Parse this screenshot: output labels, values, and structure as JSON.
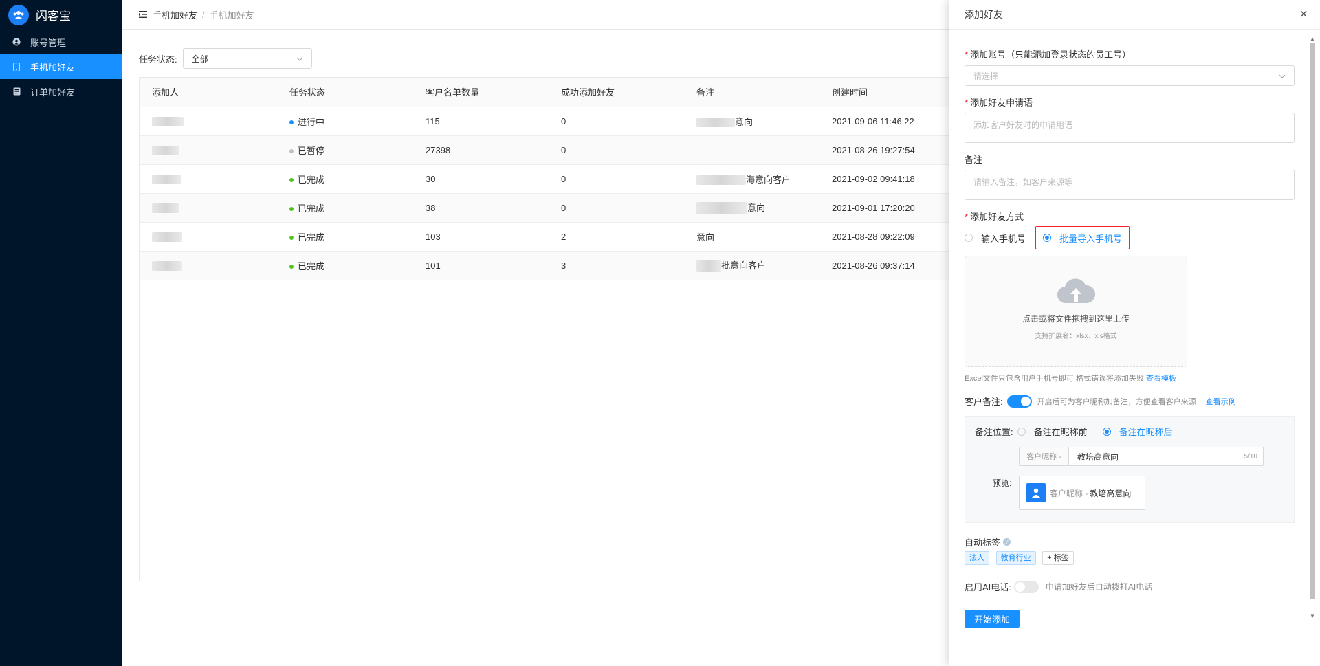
{
  "app": {
    "name": "闪客宝"
  },
  "sidebar": {
    "items": [
      {
        "label": "账号管理",
        "icon": "user-circle-icon",
        "active": false
      },
      {
        "label": "手机加好友",
        "icon": "phone-icon",
        "active": true
      },
      {
        "label": "订单加好友",
        "icon": "list-icon",
        "active": false
      }
    ]
  },
  "breadcrumb": {
    "parent": "手机加好友",
    "current": "手机加好友"
  },
  "filter": {
    "label": "任务状态:",
    "value": "全部"
  },
  "table": {
    "columns": [
      "添加人",
      "任务状态",
      "客户名单数量",
      "成功添加好友",
      "备注",
      "创建时间"
    ],
    "rows": [
      {
        "status": "进行中",
        "status_color": "blue",
        "count": "115",
        "success": "0",
        "note": "意向",
        "created": "2021-09-06 11:46:22"
      },
      {
        "status": "已暂停",
        "status_color": "gray",
        "count": "27398",
        "success": "0",
        "note": "",
        "created": "2021-08-26 19:27:54"
      },
      {
        "status": "已完成",
        "status_color": "green",
        "count": "30",
        "success": "0",
        "note": "海意向客户",
        "created": "2021-09-02 09:41:18"
      },
      {
        "status": "已完成",
        "status_color": "green",
        "count": "38",
        "success": "0",
        "note": "意向",
        "created": "2021-09-01 17:20:20"
      },
      {
        "status": "已完成",
        "status_color": "green",
        "count": "103",
        "success": "2",
        "note": "意向",
        "created": "2021-08-28 09:22:09"
      },
      {
        "status": "已完成",
        "status_color": "green",
        "count": "101",
        "success": "3",
        "note": "批意向客户",
        "created": "2021-08-26 09:37:14"
      }
    ]
  },
  "drawer": {
    "title": "添加好友",
    "account": {
      "label": "添加账号（只能添加登录状态的员工号）",
      "placeholder": "请选择"
    },
    "greeting": {
      "label": "添加好友申请语",
      "placeholder": "添加客户好友时的申请用语"
    },
    "remark": {
      "label": "备注",
      "placeholder": "请输入备注，如客户来源等"
    },
    "method": {
      "label": "添加好友方式",
      "option_manual": "输入手机号",
      "option_batch": "批量导入手机号"
    },
    "upload": {
      "main": "点击或将文件拖拽到这里上传",
      "sub": "支持扩展名：xlsx、xls格式"
    },
    "excel_hint": "Excel文件只包含用户手机号即可 格式错误将添加失败",
    "excel_link": "查看模板",
    "customer_remark": {
      "label": "客户备注:",
      "hint": "开启后可为客户昵称加备注，方便查看客户来源",
      "link": "查看示例"
    },
    "remark_position": {
      "label": "备注位置:",
      "before": "备注在昵称前",
      "after": "备注在昵称后",
      "prefix": "客户昵称 -",
      "value": "教培高意向",
      "counter": "5/10",
      "preview_label": "预览:",
      "preview_nick": "客户昵称 -",
      "preview_value": "教培高意向"
    },
    "auto_tag": {
      "label": "自动标签",
      "tags": [
        "法人",
        "教育行业"
      ],
      "add": "+ 标签"
    },
    "ai_call": {
      "label": "启用AI电话:",
      "hint": "申请加好友后自动拨打AI电话"
    },
    "submit": "开始添加"
  }
}
